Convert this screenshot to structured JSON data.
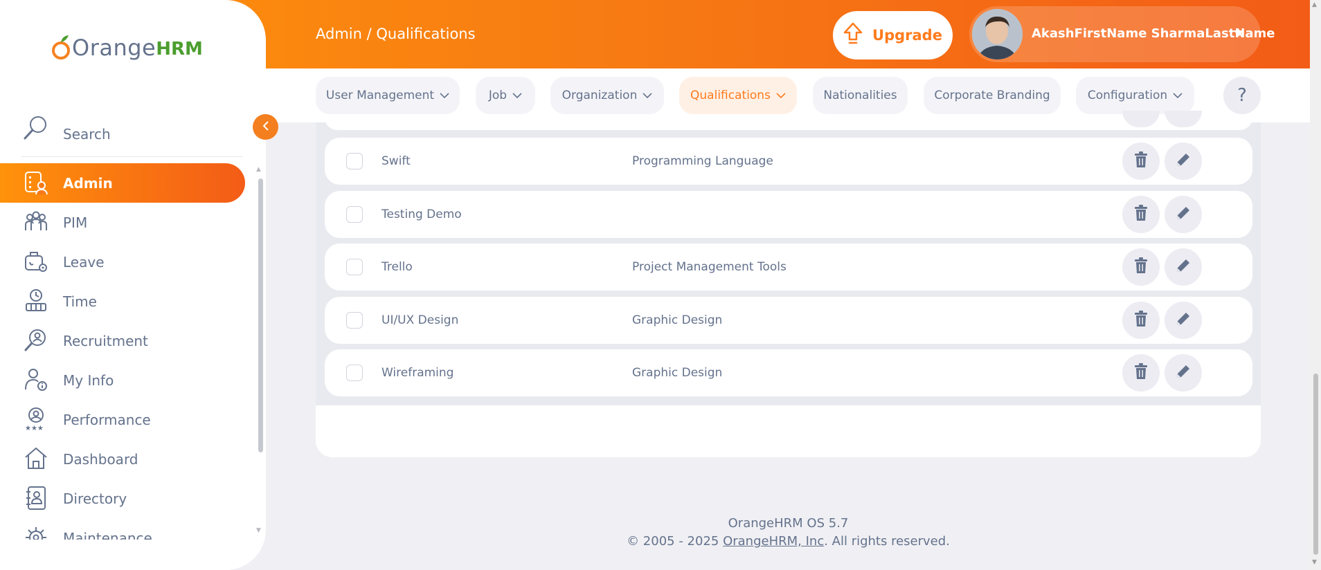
{
  "header": {
    "breadcrumb": "Admin / Qualifications",
    "upgrade_label": "Upgrade",
    "user_name": "AkashFirstName SharmaLastName"
  },
  "tabs": [
    {
      "label": "User Management",
      "has_chevron": true
    },
    {
      "label": "Job",
      "has_chevron": true
    },
    {
      "label": "Organization",
      "has_chevron": true
    },
    {
      "label": "Qualifications",
      "has_chevron": true,
      "active": true
    },
    {
      "label": "Nationalities",
      "has_chevron": false
    },
    {
      "label": "Corporate Branding",
      "has_chevron": false
    },
    {
      "label": "Configuration",
      "has_chevron": true
    }
  ],
  "help_label": "?",
  "sidebar": {
    "logo_orange": "Orange",
    "logo_hrm": "HRM",
    "search_label": "Search",
    "items": [
      {
        "label": "Admin",
        "icon": "admin-icon",
        "active": true
      },
      {
        "label": "PIM",
        "icon": "pim-icon"
      },
      {
        "label": "Leave",
        "icon": "leave-icon"
      },
      {
        "label": "Time",
        "icon": "time-icon"
      },
      {
        "label": "Recruitment",
        "icon": "recruitment-icon"
      },
      {
        "label": "My Info",
        "icon": "my-info-icon"
      },
      {
        "label": "Performance",
        "icon": "performance-icon"
      },
      {
        "label": "Dashboard",
        "icon": "dashboard-icon"
      },
      {
        "label": "Directory",
        "icon": "directory-icon"
      },
      {
        "label": "Maintenance",
        "icon": "maintenance-icon"
      }
    ]
  },
  "rows": [
    {
      "name": "Swift",
      "description": "Programming Language"
    },
    {
      "name": "Testing Demo",
      "description": ""
    },
    {
      "name": "Trello",
      "description": "Project Management Tools"
    },
    {
      "name": "UI/UX Design",
      "description": "Graphic Design"
    },
    {
      "name": "Wireframing",
      "description": "Graphic Design"
    }
  ],
  "footer": {
    "version": "OrangeHRM OS 5.7",
    "copyright_prefix": "© 2005 - 2025 ",
    "company_link": "OrangeHRM, Inc",
    "copyright_suffix": ". All rights reserved."
  },
  "colors": {
    "accent": "#ff7b1d",
    "header_gradient_start": "#ff920b",
    "header_gradient_end": "#f35c17",
    "text": "#64728c",
    "logo_green": "#4c9e2f"
  }
}
